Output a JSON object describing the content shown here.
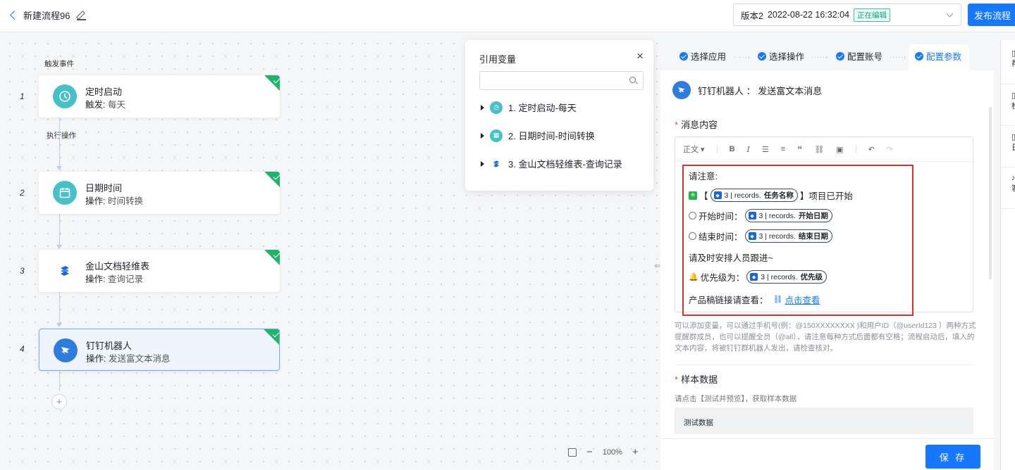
{
  "topbar": {
    "back_title": "新建流程96",
    "version_label": "版本2",
    "version_time": "2022-08-22 16:32:04",
    "version_badge": "正在编辑",
    "publish_label": "发布流程"
  },
  "canvas": {
    "trigger_label": "触发事件",
    "action_label": "执行操作",
    "nodes": [
      {
        "num": "1",
        "title": "定时启动",
        "sub_prefix": "触发: ",
        "sub_value": "每天",
        "icon": "clock-icon",
        "color": "#45c1c7"
      },
      {
        "num": "2",
        "title": "日期时间",
        "sub_prefix": "操作: ",
        "sub_value": "时间转换",
        "icon": "calendar-icon",
        "color": "#45c1c7"
      },
      {
        "num": "3",
        "title": "金山文档轻维表",
        "sub_prefix": "操作: ",
        "sub_value": "查询记录",
        "icon": "kdocs-icon",
        "color": "#1b66d6"
      },
      {
        "num": "4",
        "title": "钉钉机器人",
        "sub_prefix": "操作: ",
        "sub_value": "发送富文本消息",
        "icon": "dingtalk-icon",
        "color": "#2e7ce0"
      }
    ],
    "add_label": "+",
    "zoom": "100%"
  },
  "refpop": {
    "title": "引用变量",
    "close": "×",
    "search_placeholder": "",
    "items": [
      {
        "label": "1. 定时启动-每天",
        "icon": "clock-icon"
      },
      {
        "label": "2. 日期时间-时间转换",
        "icon": "calendar-icon"
      },
      {
        "label": "3. 金山文档轻维表-查询记录",
        "icon": "kdocs-icon"
      }
    ]
  },
  "rpanel": {
    "steps": [
      "选择应用",
      "选择操作",
      "配置账号",
      "配置参数"
    ],
    "header": "钉钉机器人 ： 发送富文本消息",
    "msg_label": "消息内容",
    "toolbar_style": "正文",
    "content": {
      "line1": "请注意:",
      "line2_open": "【",
      "line2_chip_prefix": "3 | records.",
      "line2_chip_bold": "任务名称",
      "line2_close": "】项目已开始",
      "line3_label": "开始时间：",
      "line3_chip_prefix": "3 | records.",
      "line3_chip_bold": "开始日期",
      "line4_label": "结束时间：",
      "line4_chip_prefix": "3 | records.",
      "line4_chip_bold": "结束日期",
      "line5": "请及时安排人员跟进~",
      "line6_label": "优先级为：",
      "line6_chip_prefix": "3 | records.",
      "line6_chip_bold": "优先级",
      "line7_label": "产品稿链接请查看：",
      "line7_link": "点击查看"
    },
    "hint": "可以添加变量，可以通过手机号(例：@150XXXXXXXX )和用户ID（@userId123 ）两种方式提醒群成员，也可以提醒全员（@all），请注意每种方式后面都有空格；流程启动后，填入的文本内容，将被钉钉群机器人发出，请检查核对。",
    "sample_label": "样本数据",
    "sample_hint": "请点击【测试并预览】，获取样本数据",
    "test_label": "测试数据",
    "save_label": "保 存"
  },
  "rail": {
    "items": [
      "帮",
      "检",
      "日",
      "客"
    ]
  }
}
